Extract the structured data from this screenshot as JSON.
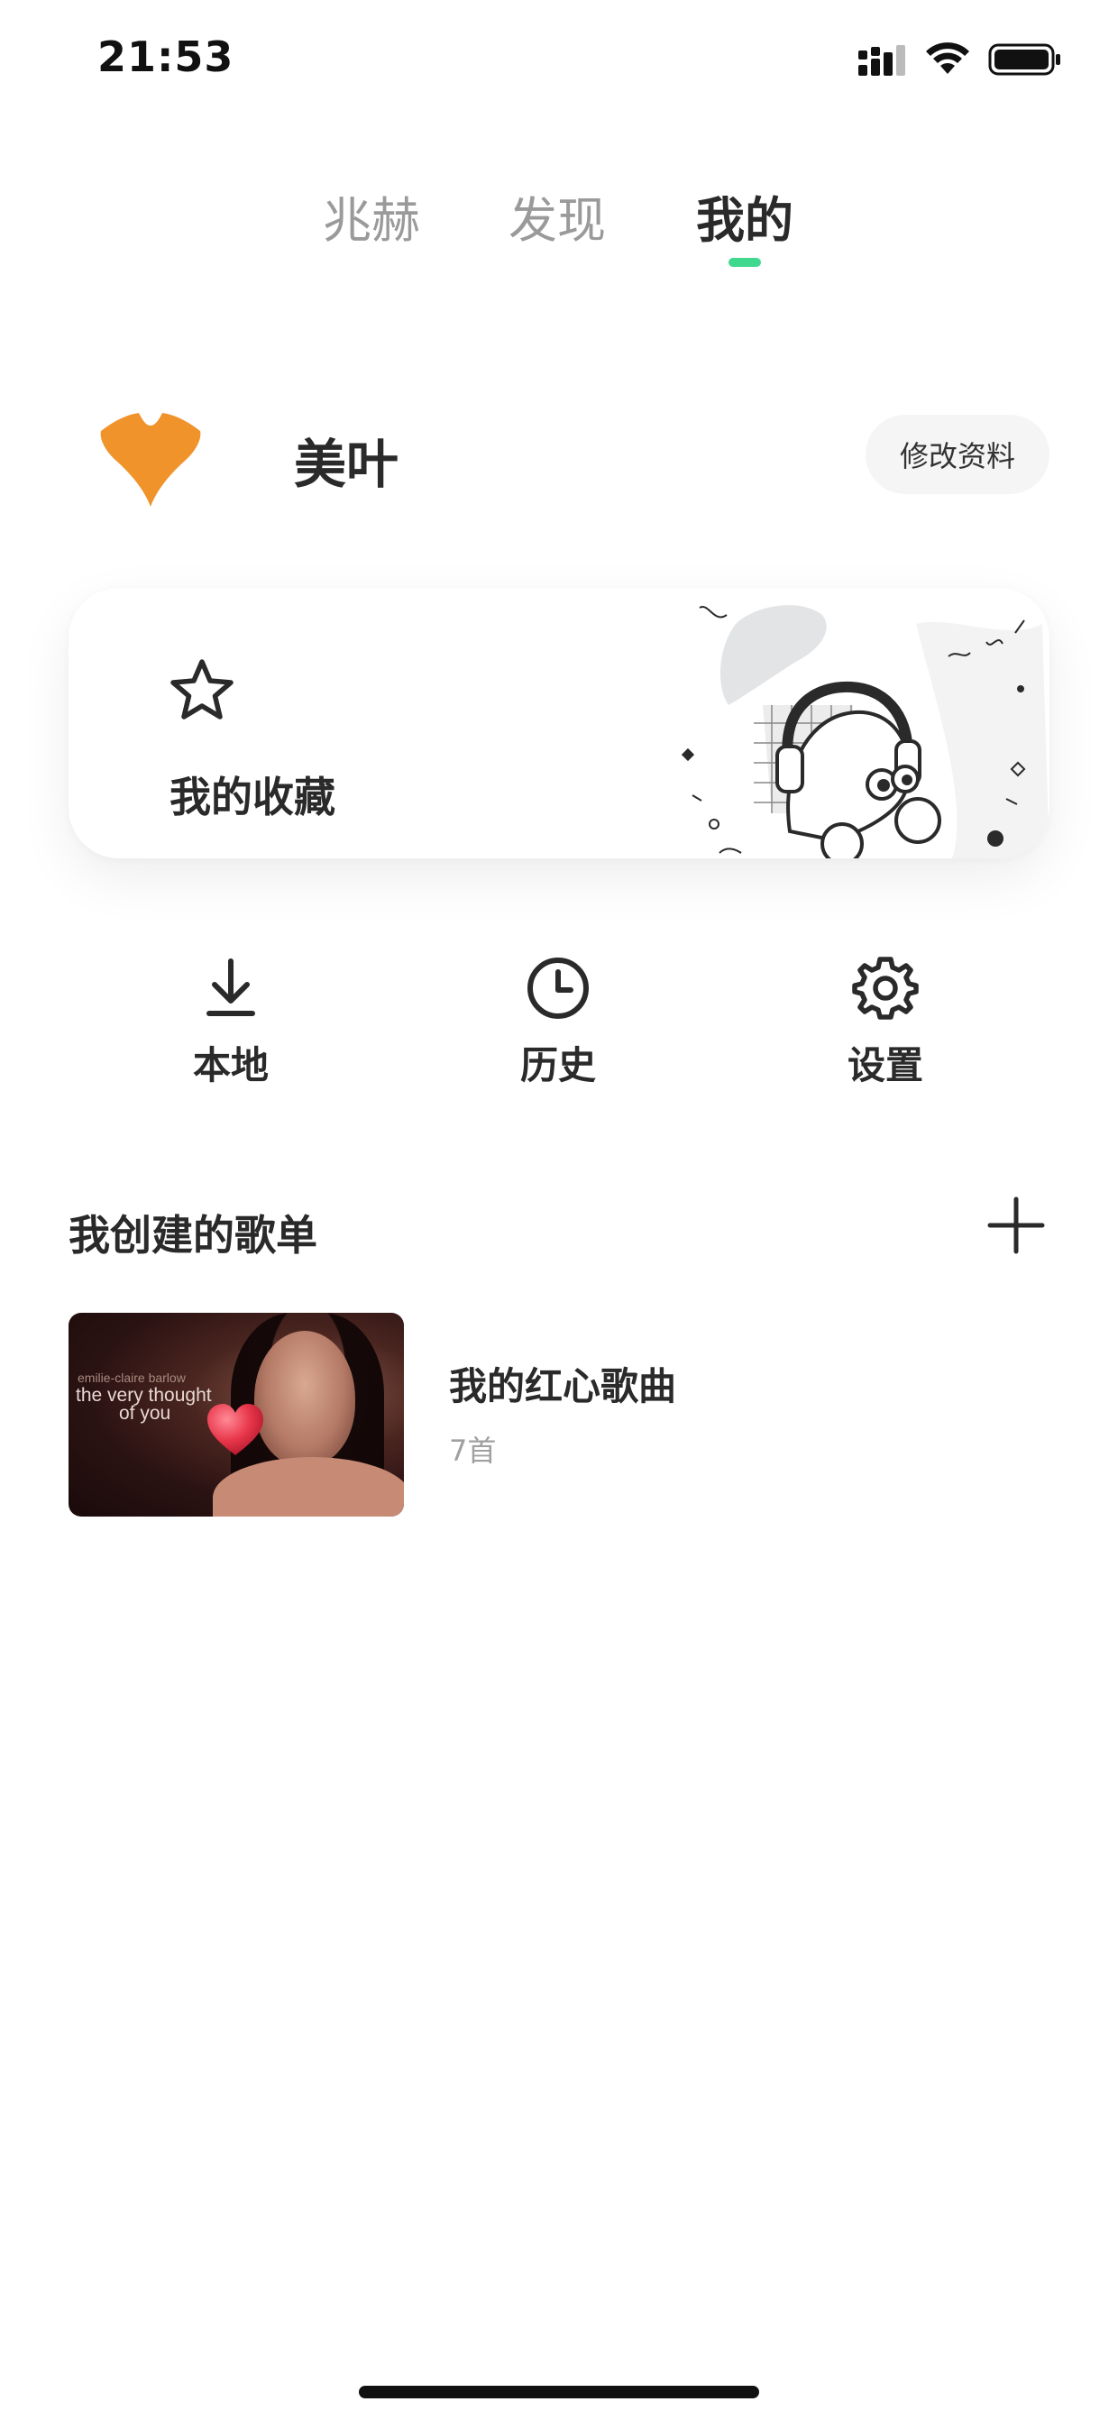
{
  "status_bar": {
    "time": "21:53"
  },
  "tabs": [
    {
      "label": "兆赫",
      "active": false
    },
    {
      "label": "发现",
      "active": false
    },
    {
      "label": "我的",
      "active": true
    }
  ],
  "profile": {
    "username": "美叶",
    "edit_label": "修改资料"
  },
  "favorites": {
    "label": "我的收藏",
    "icon": "star-icon"
  },
  "quick_actions": [
    {
      "label": "本地",
      "icon": "download-icon"
    },
    {
      "label": "历史",
      "icon": "clock-icon"
    },
    {
      "label": "设置",
      "icon": "gear-icon"
    }
  ],
  "playlists_section": {
    "title": "我创建的歌单",
    "add_icon": "plus-icon",
    "items": [
      {
        "name": "我的红心歌曲",
        "count": "7首",
        "cover_text": [
          "emilie-claire barlow",
          "the very thought",
          "of you"
        ]
      }
    ]
  },
  "colors": {
    "accent": "#3fd88e",
    "avatar": "#f0932b",
    "heart": "#e8364a"
  }
}
